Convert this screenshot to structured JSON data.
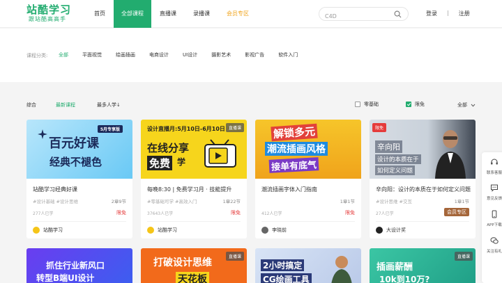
{
  "brand": {
    "name": "站酷学习",
    "slogan": "跟站酷高高手",
    "color": "#22ac6f"
  },
  "nav": [
    {
      "label": "首页",
      "active": false
    },
    {
      "label": "全部课程",
      "active": true
    },
    {
      "label": "直播课",
      "active": false
    },
    {
      "label": "录播课",
      "active": false
    },
    {
      "label": "会员专区",
      "active": false,
      "vip": true
    }
  ],
  "search": {
    "value": "C4D",
    "icon": "search-icon"
  },
  "auth": {
    "login": "登录",
    "separator": "|",
    "register": "注册"
  },
  "category": {
    "label": "课程分类:",
    "items": [
      "全部",
      "平面视觉",
      "绘画插画",
      "电商设计",
      "UI设计",
      "摄影艺术",
      "影视广告",
      "软件入门"
    ],
    "active_index": 0
  },
  "sort": {
    "items": [
      "综合",
      "最新课程",
      "最多人学"
    ],
    "active_index": 1,
    "most_arrow": "↓",
    "filters": [
      {
        "label": "零基础",
        "checked": false
      },
      {
        "label": "限免",
        "checked": true
      }
    ],
    "dropdown": "全部"
  },
  "courses": [
    {
      "thumb_badge": "",
      "thumb_lines": [
        "5月专享版",
        "百元好课",
        "经典不褪色"
      ],
      "title": "站酷学习经典好课",
      "tags": "#设计基础 #设计思维",
      "lessons": "2章9节",
      "count": "277人已学",
      "badge": "限免",
      "badge_type": "free",
      "author": "站酷学习"
    },
    {
      "thumb_badge": "直播课",
      "thumb_lines": [
        "设计直播月:5月10日-6月10日",
        "在线分享",
        "免费",
        "学"
      ],
      "title": "每晚8:30 | 免费学习月 · 技能提升",
      "tags": "#零基础可学 #高效入门",
      "lessons": "1章22节",
      "count": "37643人已学",
      "badge": "限免",
      "badge_type": "free",
      "author": "站酷学习"
    },
    {
      "thumb_badge": "",
      "thumb_lines": [
        "解锁多元",
        "潮流插画风格",
        "接单有底气"
      ],
      "title": "潮流插画字体入门指南",
      "tags": "",
      "lessons": "1章1节",
      "count": "412人已学",
      "badge": "限免",
      "badge_type": "free",
      "author": "李晓前"
    },
    {
      "thumb_badge": "限免",
      "thumb_lines": [
        "辛向阳",
        "设计的本质在于",
        "如何定义问题"
      ],
      "title": "辛向阳：设计的本质在于如何定义问题",
      "tags": "#设计思维 #交互",
      "lessons": "1章1节",
      "count": "27人已学",
      "badge": "会员专区",
      "badge_type": "vip",
      "author": "大设计奖"
    }
  ],
  "courses_row2": [
    {
      "thumb_badge": "",
      "thumb_lines": [
        "抓住行业新风口",
        "转型B端UI设计"
      ]
    },
    {
      "thumb_badge": "直播课",
      "thumb_lines": [
        "打破设计思维",
        "天花板"
      ]
    },
    {
      "thumb_badge": "",
      "thumb_lines": [
        "2小时搞定",
        "CG绘画工具"
      ]
    },
    {
      "thumb_badge": "直播课",
      "thumb_lines": [
        "插画薪酬",
        "10k到10万?"
      ]
    }
  ],
  "float_bar": [
    {
      "label": "联系客服",
      "icon": "headset-icon"
    },
    {
      "label": "意见反馈",
      "icon": "feedback-icon"
    },
    {
      "label": "APP下载",
      "icon": "phone-icon"
    },
    {
      "label": "关注有礼",
      "icon": "wechat-icon"
    }
  ]
}
